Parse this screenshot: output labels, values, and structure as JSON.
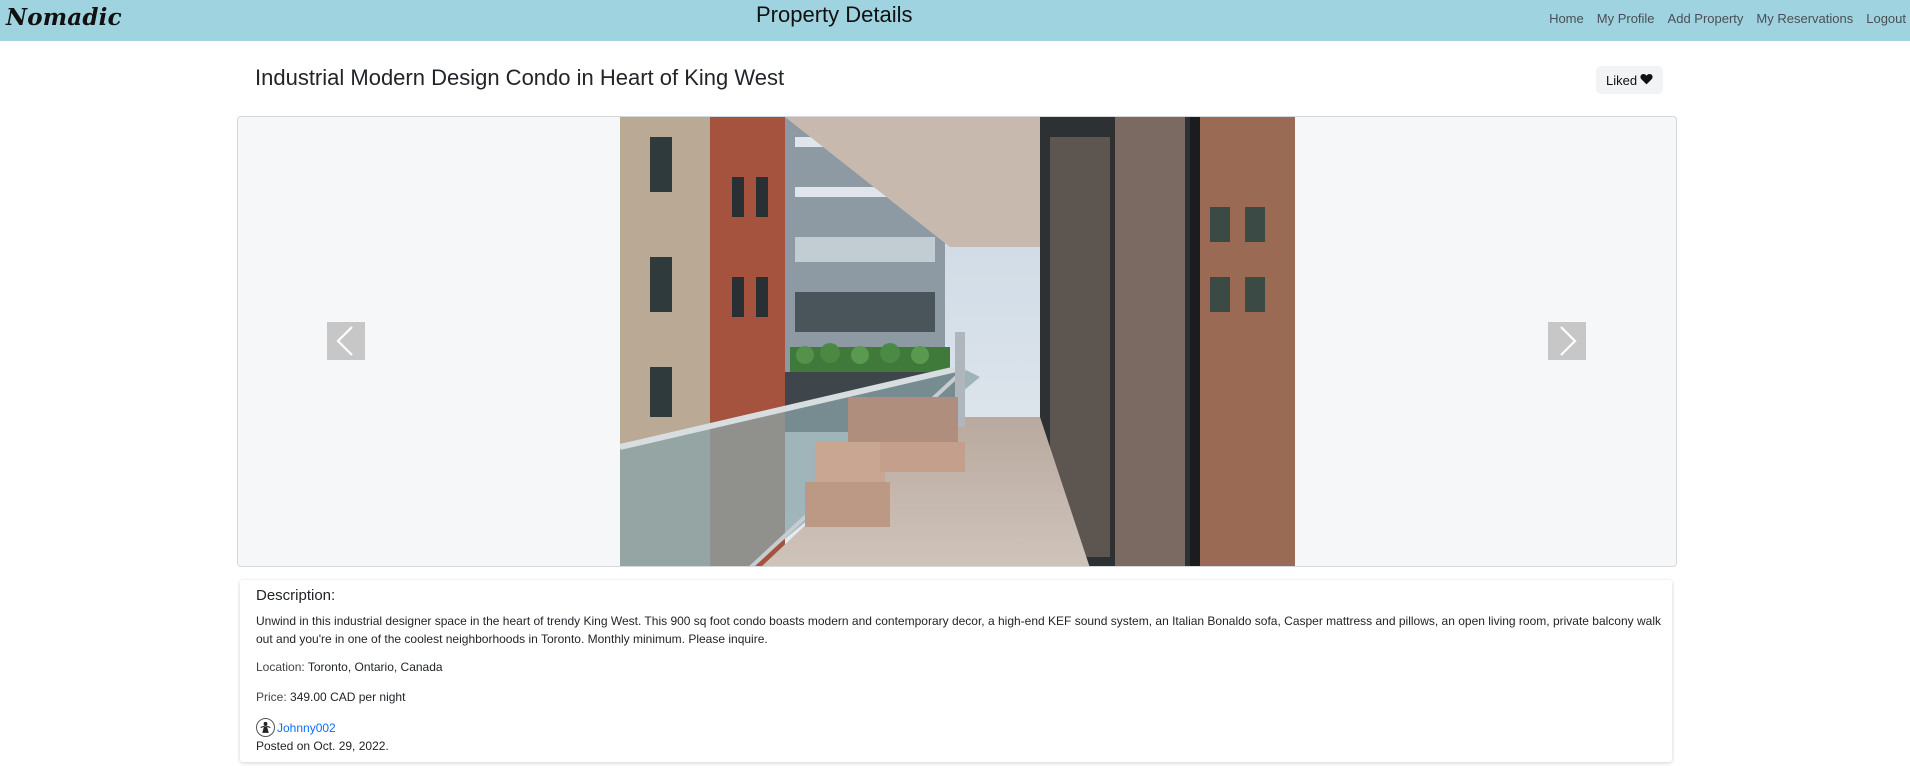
{
  "navbar": {
    "brand": "Nomadic",
    "page_title": "Property Details",
    "links": [
      "Home",
      "My Profile",
      "Add Property",
      "My Reservations",
      "Logout"
    ]
  },
  "property": {
    "title": "Industrial Modern Design Condo in Heart of King West",
    "like_label": "Liked",
    "like_icon": "heart-icon",
    "description_heading": "Description:",
    "description": "Unwind in this industrial designer space in the heart of trendy King West. This 900 sq foot condo boasts modern and contemporary decor, a high-end KEF sound system, an Italian Bonaldo sofa, Casper mattress and pillows, an open living room, private balcony walk out and you're in one of the coolest neighborhoods in Toronto. Monthly minimum. Please inquire.",
    "location_label": "Location:",
    "location": "Toronto, Ontario, Canada",
    "price_label": "Price:",
    "price": "349.00 CAD per night",
    "owner": "Johnny002",
    "posted": "Posted on Oct. 29, 2022."
  },
  "carousel": {
    "prev_icon": "chevron-left-icon",
    "next_icon": "chevron-right-icon"
  },
  "colors": {
    "navbar_bg": "#9fd3df",
    "link": "#0d6efd",
    "carousel_bg": "#f6f7f9"
  }
}
